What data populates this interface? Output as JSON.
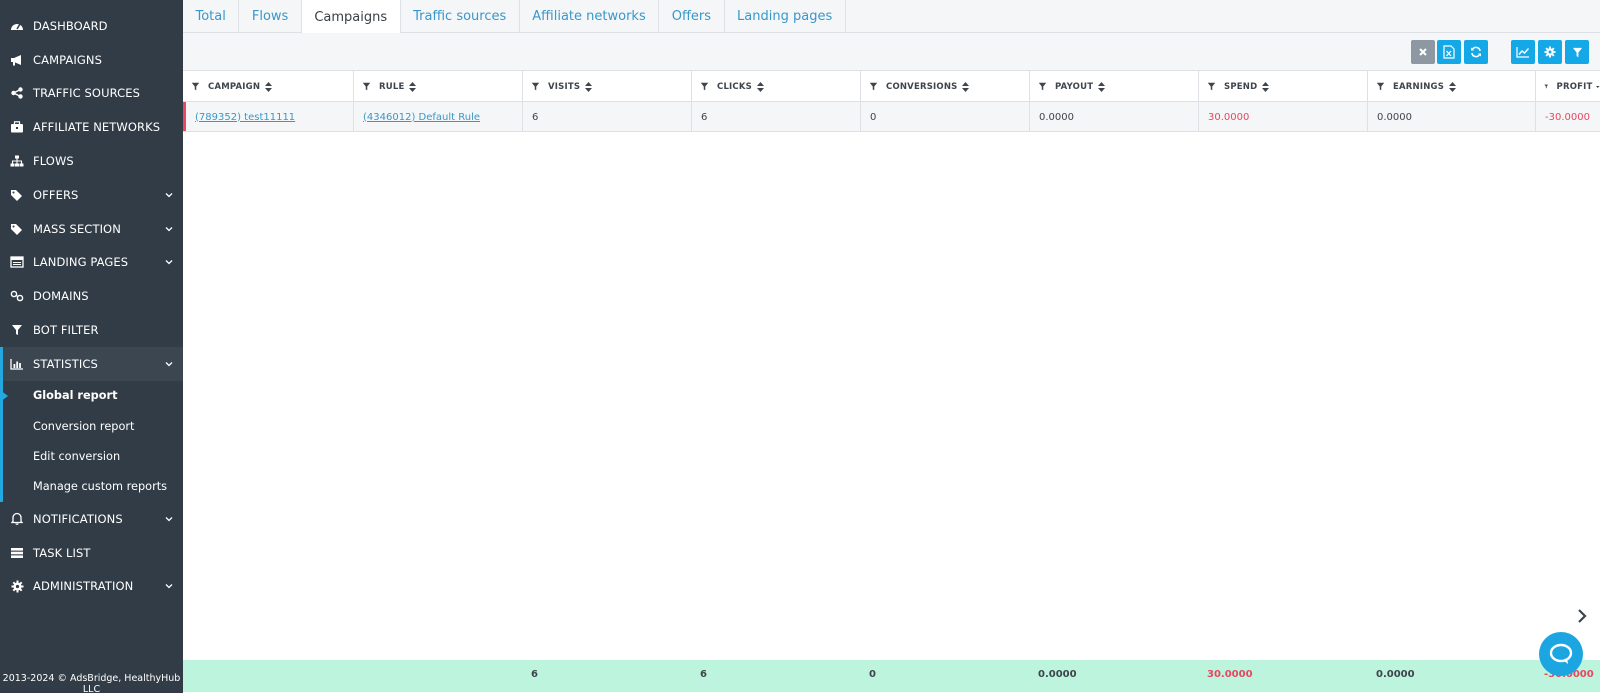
{
  "sidebar": {
    "items": [
      {
        "label": "DASHBOARD",
        "icon": "dashboard-icon"
      },
      {
        "label": "CAMPAIGNS",
        "icon": "megaphone-icon"
      },
      {
        "label": "TRAFFIC SOURCES",
        "icon": "share-icon"
      },
      {
        "label": "AFFILIATE NETWORKS",
        "icon": "briefcase-icon"
      },
      {
        "label": "FLOWS",
        "icon": "sitemap-icon"
      },
      {
        "label": "OFFERS",
        "icon": "tags-icon",
        "chevron": true
      },
      {
        "label": "MASS SECTION",
        "icon": "tags-icon",
        "chevron": true
      },
      {
        "label": "LANDING PAGES",
        "icon": "browser-icon",
        "chevron": true
      },
      {
        "label": "DOMAINS",
        "icon": "link-icon"
      },
      {
        "label": "BOT FILTER",
        "icon": "filter-icon"
      },
      {
        "label": "STATISTICS",
        "icon": "bar-chart-icon",
        "chevron": true,
        "expanded": true
      },
      {
        "label": "NOTIFICATIONS",
        "icon": "bell-icon",
        "chevron": true
      },
      {
        "label": "TASK LIST",
        "icon": "list-icon"
      },
      {
        "label": "ADMINISTRATION",
        "icon": "gear-icon",
        "chevron": true
      }
    ],
    "statistics_sub": [
      "Global report",
      "Conversion report",
      "Edit conversion",
      "Manage custom reports"
    ],
    "current_sub": "Global report",
    "copyright": "2013-2024 © AdsBridge, HealthyHub LLC"
  },
  "tabs": [
    "Total",
    "Flows",
    "Campaigns",
    "Traffic sources",
    "Affiliate networks",
    "Offers",
    "Landing pages"
  ],
  "active_tab": "Campaigns",
  "toolbar": [
    "close-icon",
    "excel-export-icon",
    "refresh-icon",
    "line-chart-icon",
    "gear-icon",
    "filter-icon"
  ],
  "table": {
    "columns": [
      "CAMPAIGN",
      "RULE",
      "VISITS",
      "CLICKS",
      "CONVERSIONS",
      "PAYOUT",
      "SPEND",
      "EARNINGS",
      "PROFIT"
    ],
    "rows": [
      {
        "campaign": "(789352) test11111",
        "rule": "(4346012) Default Rule",
        "visits": "6",
        "clicks": "6",
        "conversions": "0",
        "payout": "0.0000",
        "spend": "30.0000",
        "earnings": "0.0000",
        "profit": "-30.0000"
      }
    ],
    "totals": {
      "visits": "6",
      "clicks": "6",
      "conversions": "0",
      "payout": "0.0000",
      "spend": "30.0000",
      "earnings": "0.0000",
      "profit": "-30.0000"
    }
  },
  "colors": {
    "accent": "#15a8e6",
    "sidebar": "#323c46",
    "negative": "#e8475f",
    "footer": "#bdf4dd"
  }
}
